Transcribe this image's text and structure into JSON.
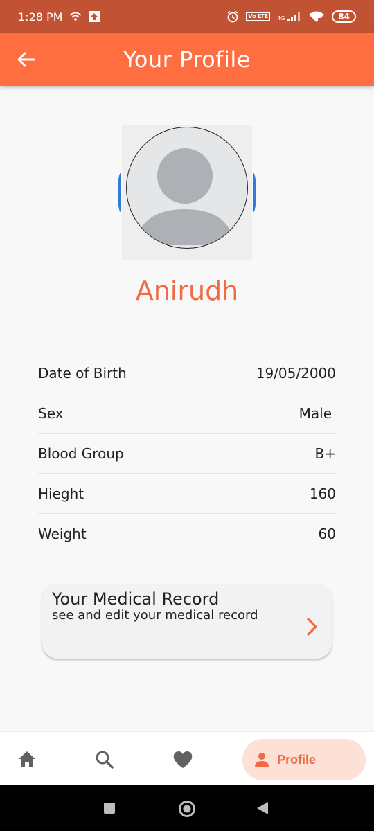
{
  "status_bar": {
    "time": "1:28 PM",
    "network": "4G",
    "lte": "Vo LTE",
    "battery": "84"
  },
  "app_bar": {
    "title": "Your Profile"
  },
  "profile": {
    "name": "Anirudh"
  },
  "details": [
    {
      "label": "Date of Birth",
      "value": "19/05/2000"
    },
    {
      "label": "Sex",
      "value": "Male"
    },
    {
      "label": "Blood Group",
      "value": "B+"
    },
    {
      "label": "Hieght",
      "value": "160"
    },
    {
      "label": "Weight",
      "value": "60"
    }
  ],
  "medical_card": {
    "title": "Your Medical Record",
    "subtitle": "see and edit your medical record"
  },
  "bottom_nav": {
    "items": [
      "home-icon",
      "search-icon",
      "heart-icon",
      "person-icon"
    ],
    "active_label": "Profile"
  },
  "colors": {
    "accent": "#ff6e40",
    "status_bar": "#c25234",
    "name_text": "#f26a42",
    "active_pill": "#fde0d6"
  }
}
